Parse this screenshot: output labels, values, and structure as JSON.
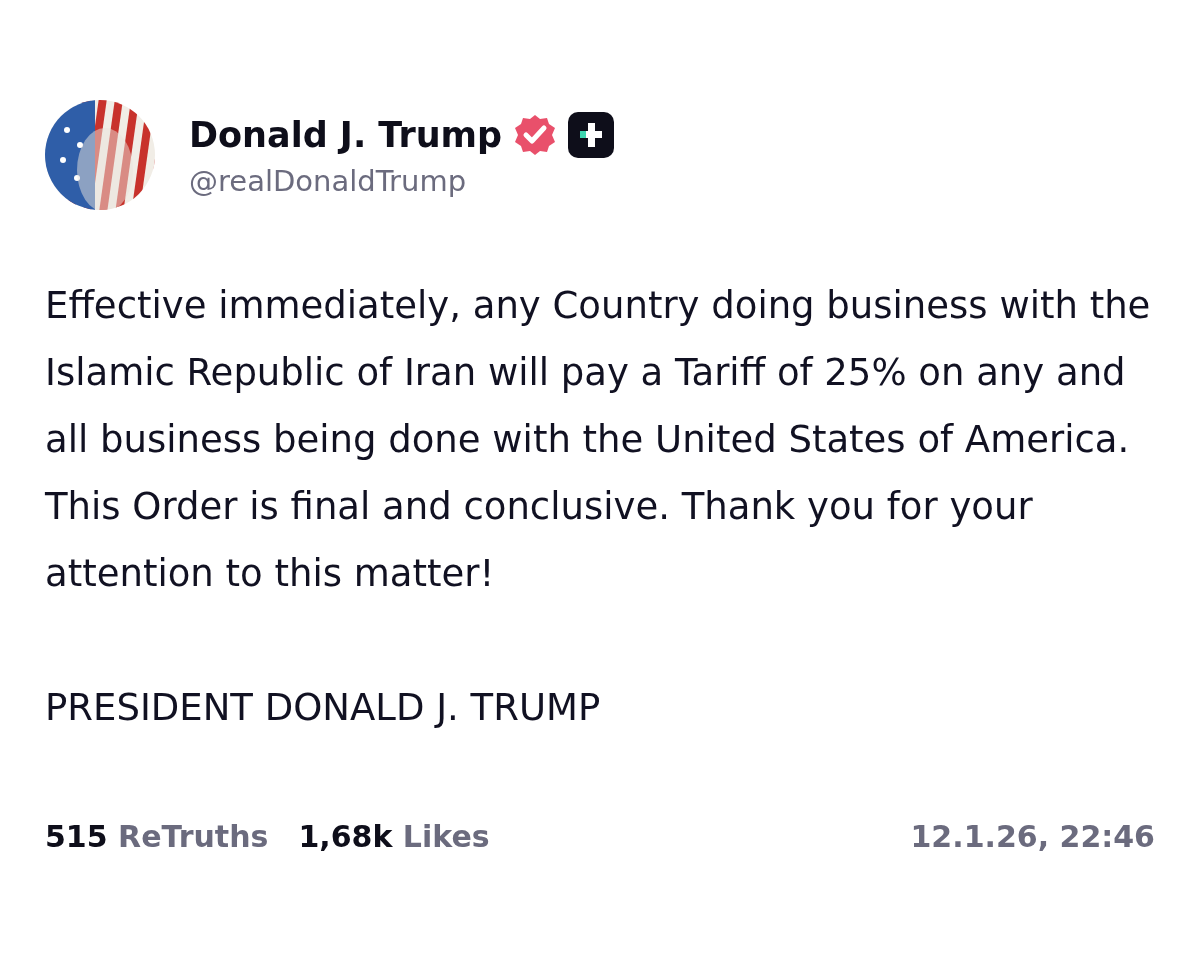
{
  "author": {
    "name": "Donald J. Trump",
    "handle": "@realDonaldTrump",
    "verified": true
  },
  "body": [
    "Effective immediately, any Country doing business with the Islamic Republic of Iran will pay a Tariff of 25% on any and all business being done with the United States of America. This Order is final and conclusive. Thank you for your attention to this matter!",
    "PRESIDENT DONALD J. TRUMP"
  ],
  "stats": [
    {
      "count": "515",
      "label": "ReTruths"
    },
    {
      "count": "1,68k",
      "label": "Likes"
    }
  ],
  "timestamp": "12.1.26, 22:46"
}
